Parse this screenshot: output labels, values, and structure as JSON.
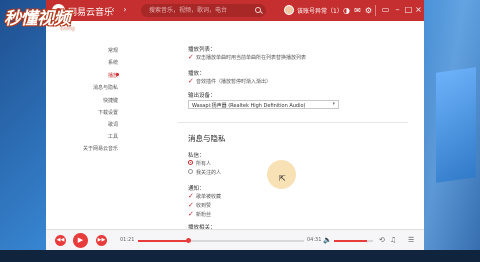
{
  "window": {
    "app_name": "网易云音乐",
    "username": "该账号异常（1）",
    "accent": "#c62f2f"
  },
  "watermark": {
    "main": "秒懂视频",
    "sub": "iDong"
  },
  "search": {
    "placeholder": "搜索音乐，视频，歌词，电台"
  },
  "titlebar_icons": [
    "prev-icon",
    "next-icon",
    "search-icon",
    "gear-icon",
    "mail-icon",
    "skin-icon",
    "mini-mode-icon",
    "minimize-icon",
    "maximize-icon",
    "close-icon"
  ],
  "sidebar": {
    "items": [
      {
        "label": "常规",
        "active": false
      },
      {
        "label": "系统",
        "active": false
      },
      {
        "label": "播放",
        "active": true
      },
      {
        "label": "消息与隐私",
        "active": false
      },
      {
        "label": "快捷键",
        "active": false
      },
      {
        "label": "下载设置",
        "active": false
      },
      {
        "label": "歌词",
        "active": false
      },
      {
        "label": "工具",
        "active": false
      },
      {
        "label": "关于网易云音乐",
        "active": false
      }
    ]
  },
  "settings": {
    "playlist_label": "播放列表：",
    "playlist_option": "双击播放单曲时用当前单曲所在列表替换播放列表",
    "effect_label": "播放：",
    "effect_option": "音效插件（播放暂停时渐入渐出）",
    "device_label": "输出设备：",
    "device_value": "Wasapi:扬声器 (Realtek High Definition Audio)",
    "privacy_title": "消息与隐私",
    "private_msg_label": "私信：",
    "radio_all": "所有人",
    "radio_follow": "我关注的人",
    "notify_label": "通知：",
    "notify_options": [
      "歌单被收藏",
      "收到赞",
      "新粉丝"
    ],
    "more_label": "播放相关："
  },
  "player": {
    "elapsed": "01:21",
    "duration": "04:31",
    "progress": 0.3,
    "volume": 0.85
  }
}
